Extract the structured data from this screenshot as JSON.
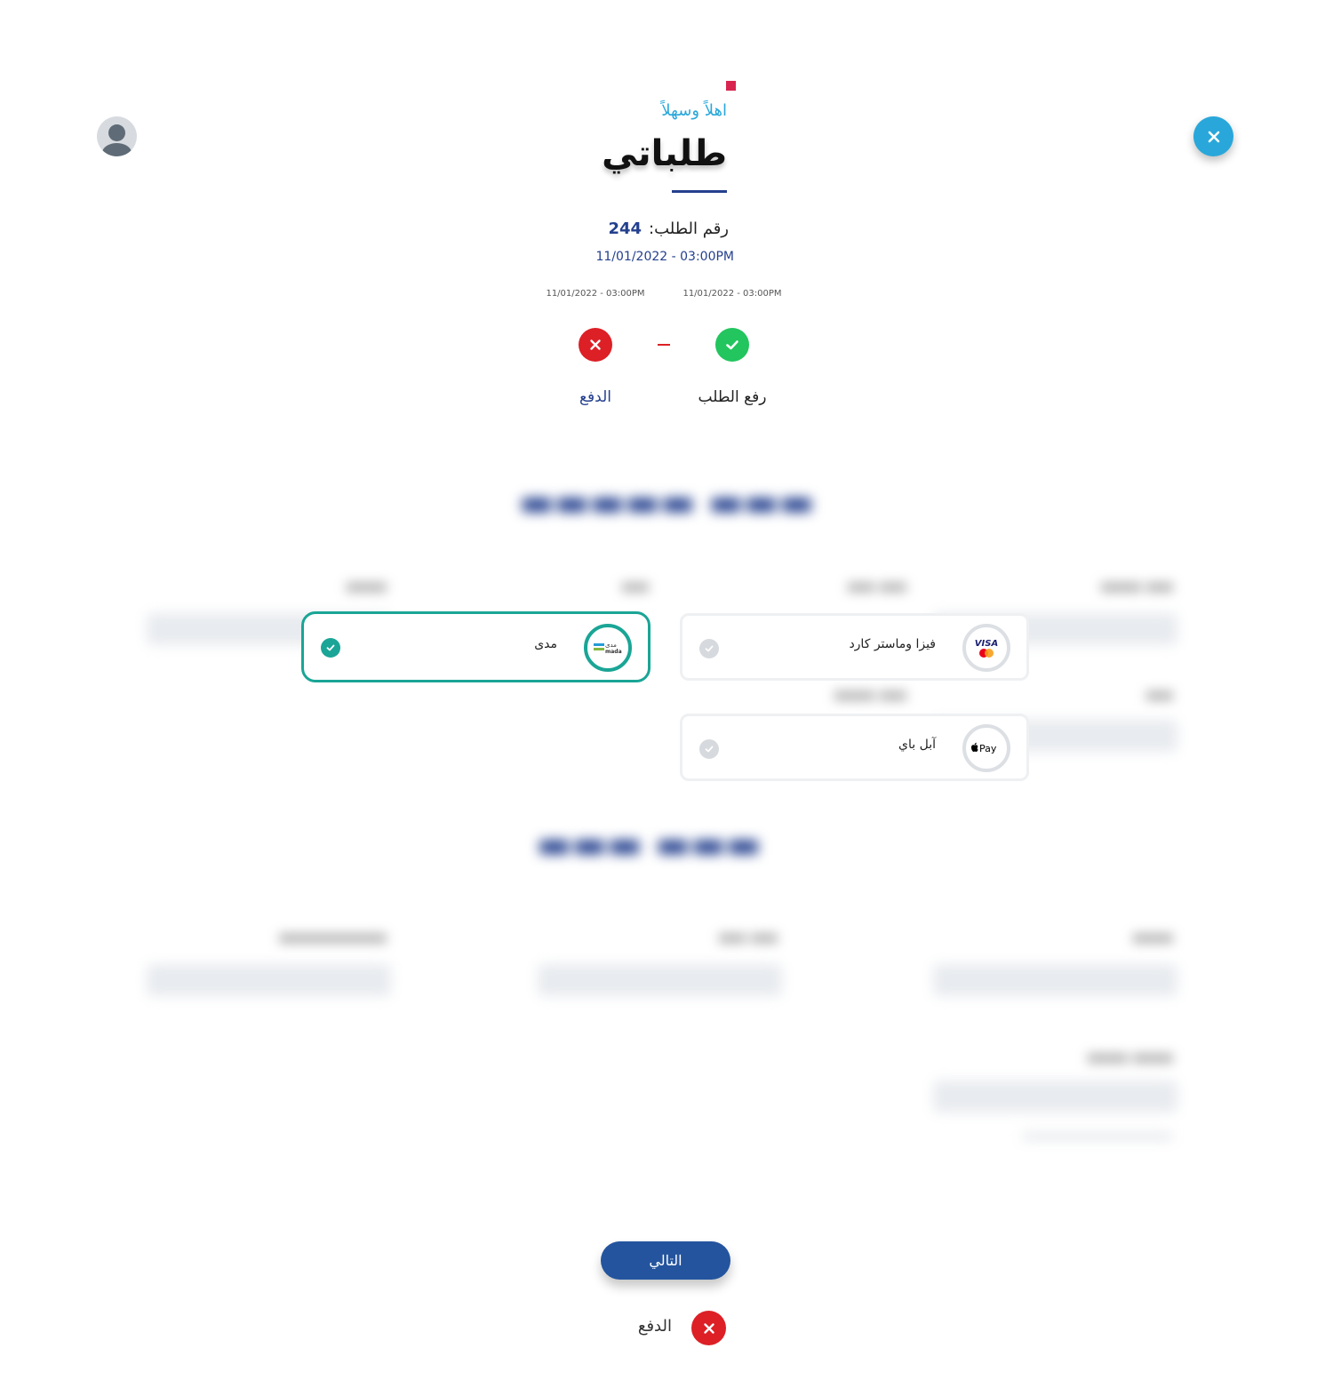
{
  "header": {
    "greeting": "اهلاً وسهلاً",
    "title": "طلباتي",
    "order_label": "رقم الطلب:",
    "order_number": "244",
    "order_datetime": "11/01/2022 - 03:00PM"
  },
  "steps": [
    {
      "label": "رفع الطلب",
      "date": "11/01/2022 - 03:00PM",
      "status": "done"
    },
    {
      "label": "الدفع",
      "date": "11/01/2022 - 03:00PM",
      "status": "failed"
    }
  ],
  "payment_options": [
    {
      "label": "فيزا وماستر كارد",
      "logo": "visa-mastercard-logo",
      "selected": false
    },
    {
      "label": "آبل باي",
      "logo": "apple-pay-logo",
      "logo_text": "Pay",
      "selected": false
    },
    {
      "label": "مدى",
      "logo": "mada-logo",
      "logo_text": "mada",
      "selected": true
    }
  ],
  "actions": {
    "next_label": "التالي",
    "bottom_status_label": "الدفع"
  },
  "colors": {
    "accent_blue": "#29a7da",
    "navy": "#24408e",
    "success": "#22c55e",
    "error": "#dc2026",
    "selected_teal": "#1aa596",
    "accent_red": "#d8254f"
  }
}
